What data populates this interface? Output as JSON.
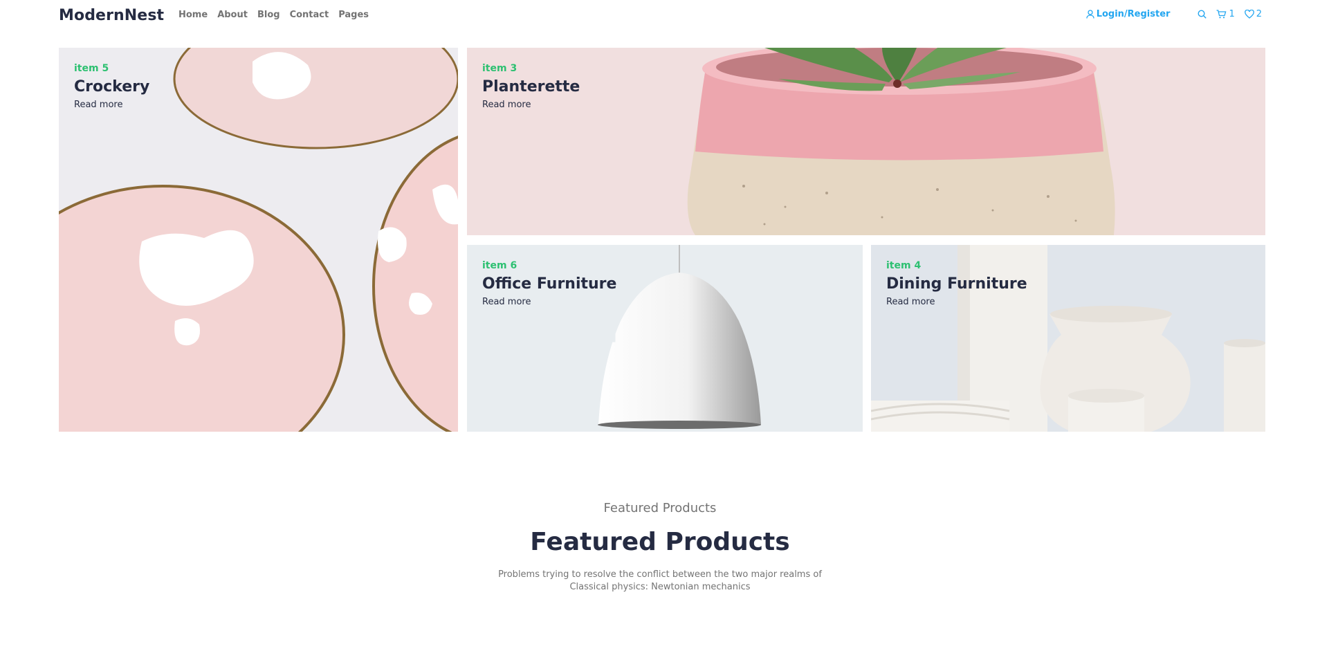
{
  "header": {
    "brand": "ModernNest",
    "nav": [
      "Home",
      "About",
      "Blog",
      "Contact",
      "Pages"
    ],
    "login_label": "Login/Register",
    "cart_count": "1",
    "wishlist_count": "2",
    "icons": {
      "user": "user-icon",
      "search": "search-icon",
      "cart": "cart-icon",
      "wishlist": "heart-icon"
    }
  },
  "cards": [
    {
      "tag": "item 5",
      "title": "Crockery",
      "link": "Read more"
    },
    {
      "tag": "item 3",
      "title": "Planterette",
      "link": "Read more"
    },
    {
      "tag": "item 6",
      "title": "Office Furniture",
      "link": "Read more"
    },
    {
      "tag": "item 4",
      "title": "Dining Furniture",
      "link": "Read more"
    }
  ],
  "featured": {
    "subtitle": "Featured Products",
    "title": "Featured Products",
    "description": "Problems trying to resolve the conflict between the two major realms of Classical physics: Newtonian mechanics"
  },
  "colors": {
    "accent": "#23a6f0",
    "tag": "#2dc071",
    "heading": "#252b42",
    "muted": "#737373"
  }
}
